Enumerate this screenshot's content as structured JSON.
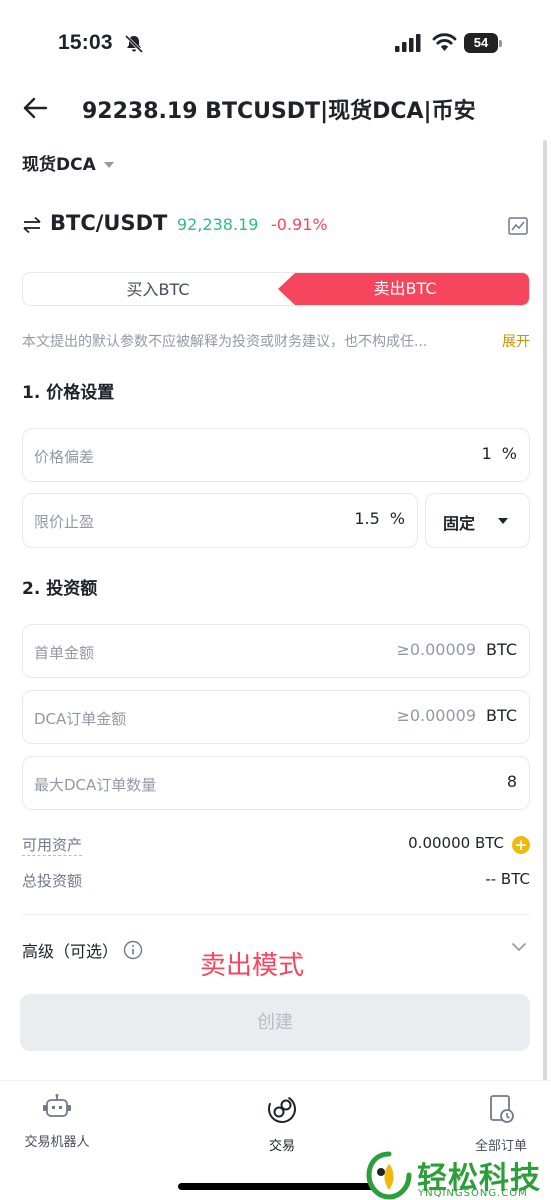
{
  "status": {
    "time": "15:03",
    "battery": "54"
  },
  "header": {
    "title": "92238.19 BTCUSDT|现货DCA|币安"
  },
  "mode": {
    "label": "现货DCA"
  },
  "pair": {
    "name": "BTC/USDT",
    "price": "92,238.19",
    "change": "-0.91%",
    "price_color": "#2ebd85",
    "change_color": "#f6465d"
  },
  "tabs": {
    "buy": "买入BTC",
    "sell": "卖出BTC",
    "active": "sell",
    "active_color": "#f6465d"
  },
  "disclaimer": {
    "text": "本文提出的默认参数不应被解释为投资或财务建议，也不构成任...",
    "more": "展开"
  },
  "section_price": {
    "title": "1. 价格设置",
    "deviation": {
      "label": "价格偏差",
      "value": "1",
      "unit": "%"
    },
    "take_profit": {
      "label": "限价止盈",
      "value": "1.5",
      "unit": "%"
    },
    "mode_select": {
      "value": "固定"
    }
  },
  "section_invest": {
    "title": "2. 投资额",
    "first_order": {
      "label": "首单金额",
      "placeholder": "≥0.00009",
      "unit": "BTC"
    },
    "dca_order": {
      "label": "DCA订单金额",
      "placeholder": "≥0.00009",
      "unit": "BTC"
    },
    "max_dca": {
      "label": "最大DCA订单数量",
      "value": "8"
    }
  },
  "summary": {
    "available_label": "可用资产",
    "available_value": "0.00000 BTC",
    "total_label": "总投资额",
    "total_value": "-- BTC"
  },
  "advanced": {
    "label": "高级（可选）"
  },
  "annotation": {
    "text": "卖出模式"
  },
  "create_button": {
    "label": "创建"
  },
  "bottom_nav": {
    "items": [
      {
        "label": "交易机器人",
        "icon": "robot-icon"
      },
      {
        "label": "交易",
        "icon": "trade-icon"
      },
      {
        "label": "全部订单",
        "icon": "orders-icon"
      }
    ]
  },
  "watermark": {
    "text": "轻松科技",
    "sub": "YNQINGSONG.COM"
  }
}
